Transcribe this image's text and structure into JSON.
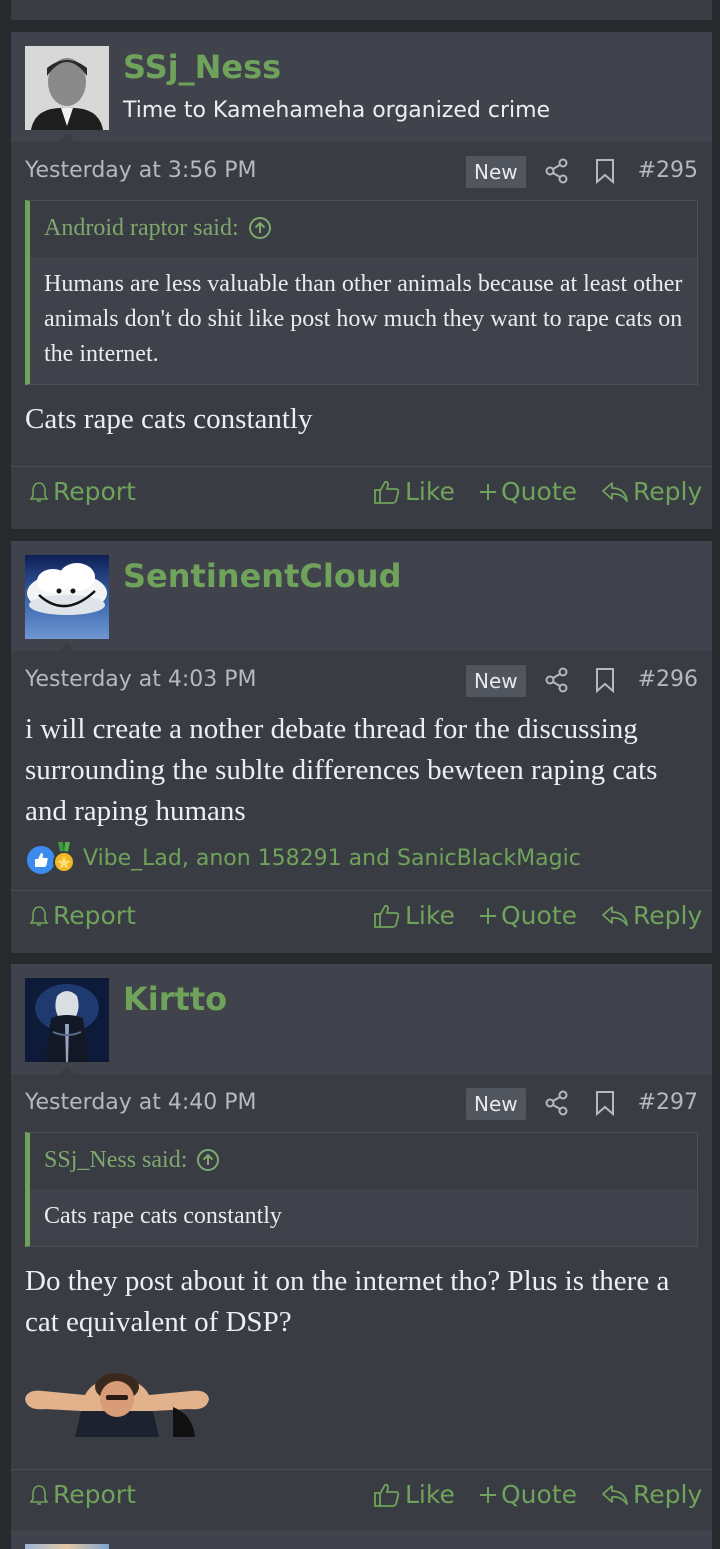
{
  "posts": [
    {
      "username": "SSj_Ness",
      "user_title": "Time to Kamehameha organized crime",
      "date": "Yesterday at 3:56 PM",
      "new_badge": "New",
      "post_number": "#295",
      "quote": {
        "attribution": "Android raptor said:",
        "text": "Humans are less valuable than other animals because at least other animals don't do shit like post how much they want to rape cats on the internet."
      },
      "message": "Cats rape cats constantly",
      "actions": {
        "report": "Report",
        "like": "Like",
        "quote": "Quote",
        "reply": "Reply"
      }
    },
    {
      "username": "SentinentCloud",
      "user_title": "",
      "date": "Yesterday at 4:03 PM",
      "new_badge": "New",
      "post_number": "#296",
      "message": "i will create a nother debate thread for the discussing surrounding the sublte differences bewteen raping cats and raping humans",
      "reactions": "Vibe_Lad, anon 158291 and SanicBlackMagic",
      "actions": {
        "report": "Report",
        "like": "Like",
        "quote": "Quote",
        "reply": "Reply"
      }
    },
    {
      "username": "Kirtto",
      "user_title": "",
      "date": "Yesterday at 4:40 PM",
      "new_badge": "New",
      "post_number": "#297",
      "quote": {
        "attribution": "SSj_Ness said:",
        "text": "Cats rape cats constantly"
      },
      "message": "Do they post about it on the internet tho? Plus is there a cat equivalent of DSP?",
      "actions": {
        "report": "Report",
        "like": "Like",
        "quote": "Quote",
        "reply": "Reply"
      }
    }
  ],
  "colors": {
    "accent": "#6fa35b",
    "background": "#27292d",
    "card": "#393c43",
    "header": "#40434b"
  },
  "icons": [
    "share-icon",
    "bookmark-icon",
    "bell-icon",
    "thumbs-up-icon",
    "plus-icon",
    "reply-arrow-icon",
    "arrow-up-circle-icon"
  ]
}
